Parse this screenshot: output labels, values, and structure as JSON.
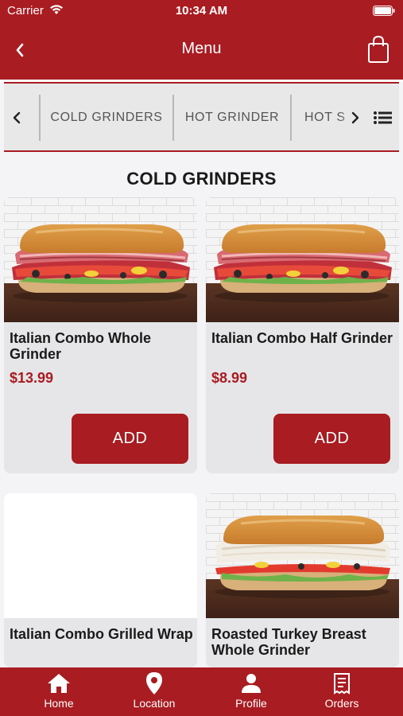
{
  "status_bar": {
    "carrier": "Carrier",
    "time": "10:34 AM"
  },
  "header": {
    "title": "Menu"
  },
  "tabs": [
    {
      "label": "COLD GRINDERS"
    },
    {
      "label": "HOT GRINDER"
    },
    {
      "label": "HOT S"
    }
  ],
  "section": {
    "title": "COLD GRINDERS"
  },
  "products": [
    {
      "name": "Italian Combo Whole Grinder",
      "price": "$13.99",
      "add_label": "ADD",
      "image": "italian-combo-sandwich"
    },
    {
      "name": "Italian Combo Half Grinder",
      "price": "$8.99",
      "add_label": "ADD",
      "image": "italian-combo-sandwich"
    },
    {
      "name": "Italian Combo Grilled Wrap",
      "price": "",
      "add_label": "",
      "image": "blank"
    },
    {
      "name": "Roasted Turkey Breast Whole Grinder",
      "price": "",
      "add_label": "",
      "image": "turkey-sandwich"
    }
  ],
  "bottom_nav": [
    {
      "label": "Home",
      "icon": "home-icon"
    },
    {
      "label": "Location",
      "icon": "location-pin-icon"
    },
    {
      "label": "Profile",
      "icon": "person-icon"
    },
    {
      "label": "Orders",
      "icon": "receipt-icon"
    }
  ],
  "colors": {
    "brand": "#a81c22",
    "card": "#e6e6e8",
    "background": "#f4f4f6"
  }
}
